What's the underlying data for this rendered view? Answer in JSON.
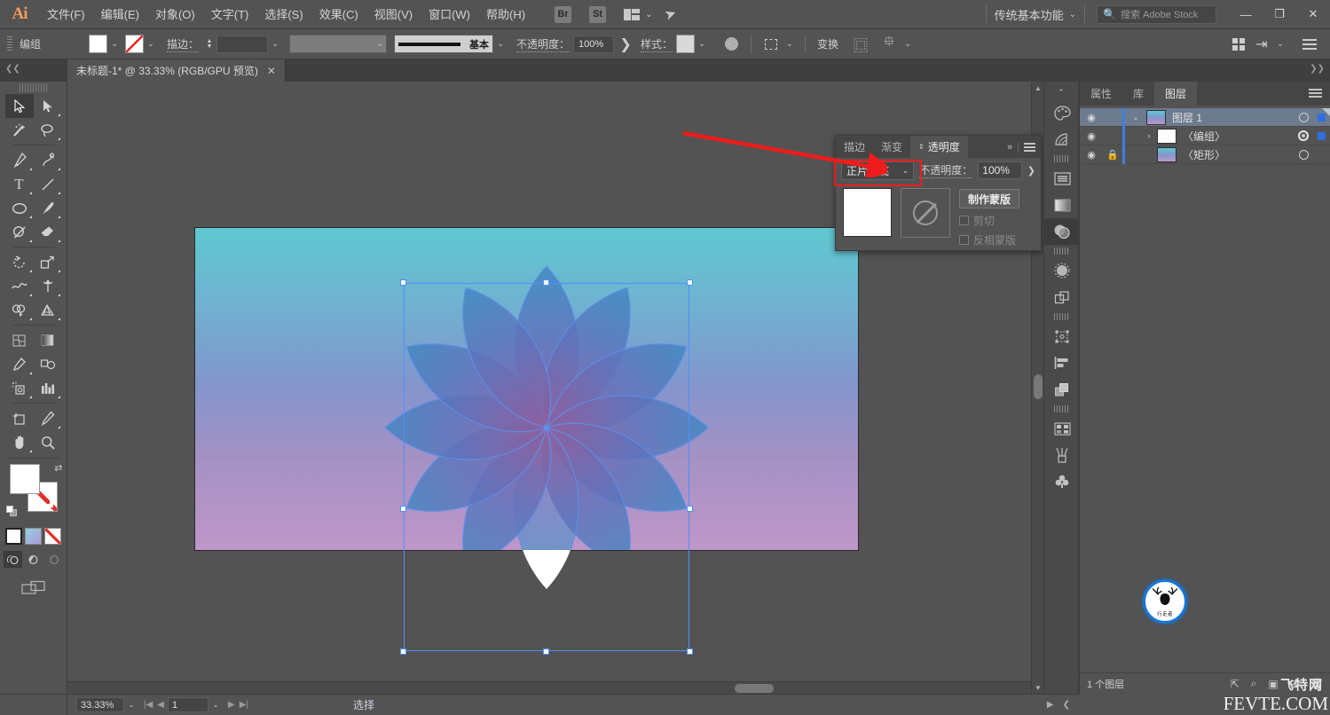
{
  "app": {
    "name": "Ai",
    "menus": [
      "文件(F)",
      "编辑(E)",
      "对象(O)",
      "文字(T)",
      "选择(S)",
      "效果(C)",
      "视图(V)",
      "窗口(W)",
      "帮助(H)"
    ],
    "bridge_badge": "Br",
    "stock_badge": "St",
    "workspace": "传统基本功能",
    "search_placeholder": "搜索 Adobe Stock",
    "window_buttons": {
      "minimize": "—",
      "maximize": "❐",
      "close": "✕"
    }
  },
  "control_bar": {
    "selection_label": "编组",
    "stroke_label": "描边：",
    "stroke_weight": "",
    "stroke_profile_label": "基本",
    "opacity_label": "不透明度：",
    "opacity_value": "100%",
    "style_label": "样式：",
    "transform_label": "变换"
  },
  "document": {
    "tab_title": "未标题-1* @ 33.33% (RGB/GPU 预览)",
    "close_glyph": "✕"
  },
  "transparency_panel": {
    "tabs": [
      "描边",
      "渐变",
      "透明度"
    ],
    "active_tab": "透明度",
    "blend_mode": "正片叠底",
    "opacity_label": "不透明度：",
    "opacity_value": "100%",
    "make_mask_button": "制作蒙版",
    "clip_checkbox": "剪切",
    "invert_mask_checkbox": "反相蒙版",
    "highlight_color": "#ee1c1c"
  },
  "layers_panel": {
    "tabs": [
      "属性",
      "库",
      "图层"
    ],
    "active_tab": "图层",
    "rows": [
      {
        "name": "图层 1",
        "eye": "◉",
        "lock": "",
        "selected": true,
        "indent": 0,
        "thumb": "grad",
        "expander": "⌄",
        "target": "circle",
        "has_select_square": true
      },
      {
        "name": "〈编组〉",
        "eye": "◉",
        "lock": "",
        "selected": false,
        "indent": 1,
        "thumb": "white",
        "expander": "›",
        "target": "double",
        "has_select_square": true
      },
      {
        "name": "〈矩形〉",
        "eye": "◉",
        "lock": "🔒",
        "selected": false,
        "indent": 1,
        "thumb": "grad",
        "expander": "",
        "target": "circle",
        "has_select_square": false
      }
    ],
    "footer_count": "1 个图层"
  },
  "status_bar": {
    "zoom": "33.33%",
    "page": "1",
    "status_text": "选择"
  },
  "artwork": {
    "petal_count": 12,
    "gradient_top": "#5ec8d0",
    "gradient_mid": "#8296cd",
    "gradient_bottom": "#bf96c8",
    "selection_color": "#4f8ff7"
  },
  "watermark": {
    "logo_text": "行走者",
    "site_cn": "飞特网",
    "site_en": "FEVTE.COM"
  },
  "tooltips": {
    "icons": "icon-only dock"
  }
}
